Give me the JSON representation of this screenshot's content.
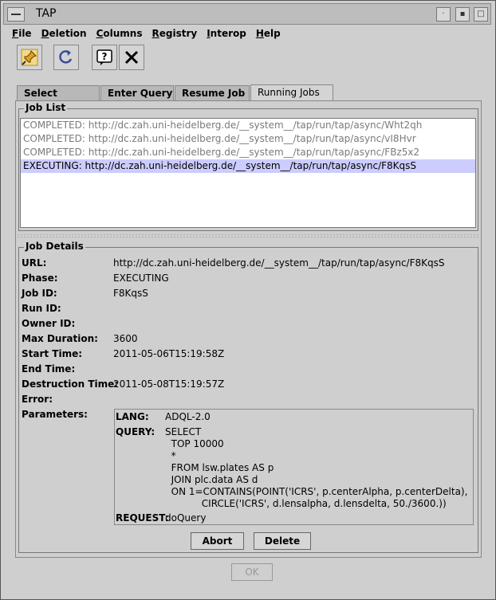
{
  "window": {
    "title": "TAP"
  },
  "menu": [
    "File",
    "Deletion",
    "Columns",
    "Registry",
    "Interop",
    "Help"
  ],
  "toolbar": {
    "icons": [
      "pin-icon",
      "refresh-icon",
      "help-icon",
      "close-icon"
    ]
  },
  "tabs": [
    "Select Service",
    "Enter Query",
    "Resume Job",
    "Running Jobs"
  ],
  "active_tab": "Running Jobs",
  "job_list": {
    "label": "Job List",
    "items": [
      {
        "text": "COMPLETED:  http://dc.zah.uni-heidelberg.de/__system__/tap/run/tap/async/Wht2qh",
        "selected": false
      },
      {
        "text": "COMPLETED:  http://dc.zah.uni-heidelberg.de/__system__/tap/run/tap/async/vI8Hvr",
        "selected": false
      },
      {
        "text": "COMPLETED:  http://dc.zah.uni-heidelberg.de/__system__/tap/run/tap/async/FBz5x2",
        "selected": false
      },
      {
        "text": "EXECUTING:  http://dc.zah.uni-heidelberg.de/__system__/tap/run/tap/async/F8KqsS",
        "selected": true
      }
    ]
  },
  "details": {
    "label": "Job Details",
    "rows": [
      {
        "label": "URL:",
        "value": "http://dc.zah.uni-heidelberg.de/__system__/tap/run/tap/async/F8KqsS"
      },
      {
        "label": "Phase:",
        "value": "EXECUTING"
      },
      {
        "label": "Job ID:",
        "value": "F8KqsS"
      },
      {
        "label": "Run ID:",
        "value": ""
      },
      {
        "label": "Owner ID:",
        "value": ""
      },
      {
        "label": "Max Duration:",
        "value": "3600"
      },
      {
        "label": "Start Time:",
        "value": "2011-05-06T15:19:58Z"
      },
      {
        "label": "End Time:",
        "value": ""
      },
      {
        "label": "Destruction Time:",
        "value": "2011-05-08T15:19:57Z"
      },
      {
        "label": "Error:",
        "value": ""
      },
      {
        "label": "Parameters:",
        "value": ""
      }
    ],
    "params": {
      "lang_label": "LANG:",
      "lang_value": "ADQL-2.0",
      "query_label": "QUERY:",
      "query_lines": [
        "SELECT",
        "  TOP 10000",
        "  *",
        "  FROM lsw.plates AS p",
        "  JOIN plc.data AS d",
        "  ON 1=CONTAINS(POINT('ICRS', p.centerAlpha, p.centerDelta),",
        "            CIRCLE('ICRS', d.lensalpha, d.lensdelta, 50./3600.))"
      ],
      "request_label": "REQUEST:",
      "request_value": "doQuery"
    }
  },
  "buttons": {
    "abort": "Abort",
    "delete": "Delete",
    "ok": "OK"
  }
}
